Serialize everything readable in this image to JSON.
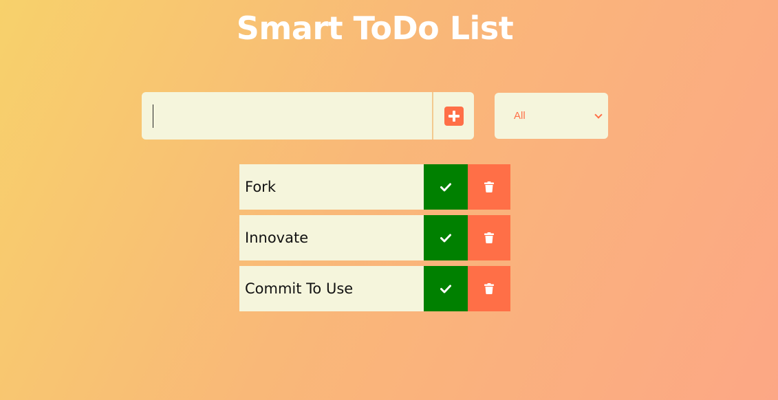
{
  "app": {
    "title": "Smart ToDo List"
  },
  "form": {
    "input_value": "",
    "add_icon": "plus-square-icon"
  },
  "filter": {
    "selected": "All"
  },
  "todos": [
    {
      "text": "Fork",
      "complete_icon": "check-icon",
      "delete_icon": "trash-icon"
    },
    {
      "text": "Innovate",
      "complete_icon": "check-icon",
      "delete_icon": "trash-icon"
    },
    {
      "text": "Commit To Use",
      "complete_icon": "check-icon",
      "delete_icon": "trash-icon"
    }
  ],
  "colors": {
    "accent": "#ff6f47",
    "complete": "#008000",
    "surface": "#f5f5dc",
    "title": "#ffffff"
  }
}
